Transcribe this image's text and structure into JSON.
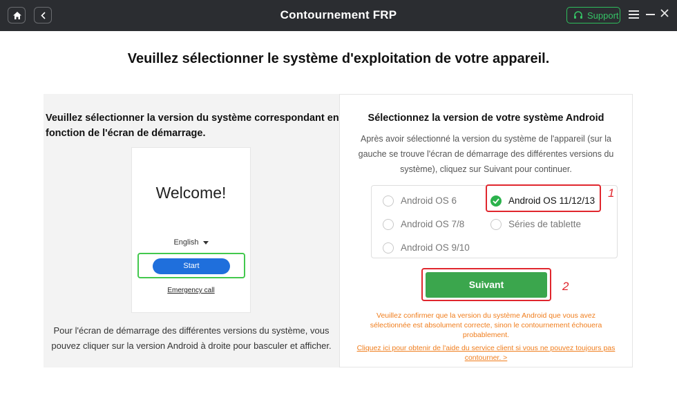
{
  "window": {
    "title": "Contournement FRP",
    "support_label": "Support",
    "icons": [
      "home-icon",
      "back-icon",
      "headset-icon",
      "menu-icon",
      "minimize-icon",
      "close-icon"
    ]
  },
  "heading": "Veuillez sélectionner le système d'exploitation de votre appareil.",
  "left": {
    "title": "Veuillez sélectionner la version du système correspondant en fonction de l'écran de démarrage.",
    "phone": {
      "welcome": "Welcome!",
      "language": "English",
      "start": "Start",
      "emergency": "Emergency call"
    },
    "description": "Pour l'écran de démarrage des différentes versions du système, vous pouvez cliquer sur la version Android à droite pour basculer et afficher."
  },
  "right": {
    "title": "Sélectionnez la version de votre système Android",
    "description": "Après avoir sélectionné la version du système de l'appareil (sur la gauche se trouve l'écran de démarrage des différentes versions du système), cliquez sur Suivant pour continuer.",
    "options": [
      {
        "label": "Android OS 6",
        "selected": false
      },
      {
        "label": "Android OS 7/8",
        "selected": false
      },
      {
        "label": "Android OS 9/10",
        "selected": false
      },
      {
        "label": "Android OS 11/12/13",
        "selected": true
      },
      {
        "label": "Séries de tablette",
        "selected": false
      }
    ],
    "next_label": "Suivant",
    "warning": "Veuillez confirmer que la version du système Android que vous avez sélectionnée est absolument correcte, sinon le contournement échouera probablement.",
    "help_link": "Cliquez ici pour obtenir de l'aide du service client si vous ne pouvez toujours pas contourner. >"
  },
  "annotations": {
    "marker_1": "1",
    "marker_2": "2"
  },
  "colors": {
    "titlebar": "#2b2d31",
    "accent_green": "#3ba64d",
    "highlight_red": "#e0262d",
    "warning_orange": "#f07d1c",
    "phone_button_blue": "#1f6fdc"
  }
}
